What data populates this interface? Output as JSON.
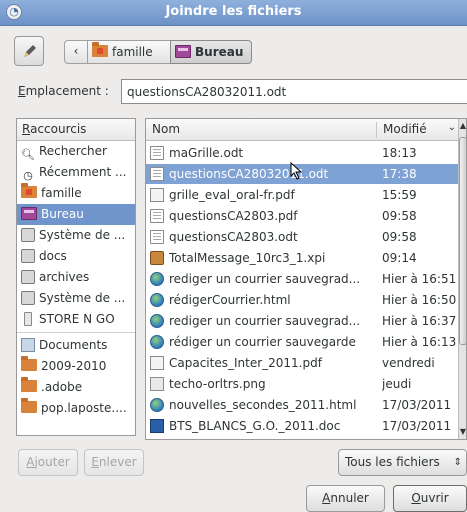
{
  "window": {
    "title": "Joindre les fichiers"
  },
  "path": {
    "back_label": "‹",
    "segments": [
      "famille",
      "Bureau"
    ]
  },
  "location": {
    "label_prefix": "",
    "label_accel": "E",
    "label_rest": "mplacement :",
    "value": "questionsCA28032011.odt"
  },
  "places": {
    "header_accel": "R",
    "header_rest": "accourcis",
    "items": [
      {
        "label": "Rechercher",
        "icon": "search-icon"
      },
      {
        "label": "Récemment ...",
        "icon": "recent-icon"
      },
      {
        "label": "famille",
        "icon": "home-folder-icon"
      },
      {
        "label": "Bureau",
        "icon": "desktop-icon",
        "selected": true
      },
      {
        "label": "Système de ...",
        "icon": "drive-icon"
      },
      {
        "label": "docs",
        "icon": "drive-icon"
      },
      {
        "label": "archives",
        "icon": "drive-icon"
      },
      {
        "label": "Système de ...",
        "icon": "drive-icon"
      },
      {
        "label": "STORE N GO",
        "icon": "usb-drive-icon"
      }
    ],
    "bookmarks": [
      {
        "label": "Documents",
        "icon": "documents-folder-icon"
      },
      {
        "label": "2009-2010",
        "icon": "folder-icon"
      },
      {
        "label": ".adobe",
        "icon": "folder-icon"
      },
      {
        "label": "pop.laposte....",
        "icon": "folder-icon"
      }
    ]
  },
  "files": {
    "col_name": "Nom",
    "col_modified": "Modifié",
    "sort_arrow": "⌄",
    "rows": [
      {
        "name": "maGrille.odt",
        "modified": "18:13",
        "icon": "document-icon"
      },
      {
        "name": "questionsCA28032011.odt",
        "modified": "17:38",
        "icon": "document-icon",
        "selected": true
      },
      {
        "name": "grille_eval_oral-fr.pdf",
        "modified": "15:59",
        "icon": "pdf-icon"
      },
      {
        "name": "questionsCA2803.pdf",
        "modified": "09:58",
        "icon": "document-icon"
      },
      {
        "name": "questionsCA2803.odt",
        "modified": "09:58",
        "icon": "document-icon"
      },
      {
        "name": "TotalMessage_10rc3_1.xpi",
        "modified": "09:14",
        "icon": "package-icon"
      },
      {
        "name": "rediger un courrier sauvegrad...",
        "modified": "Hier à 16:51",
        "icon": "globe-icon"
      },
      {
        "name": "rédigerCourrier.html",
        "modified": "Hier à 16:50",
        "icon": "globe-icon"
      },
      {
        "name": "rediger un courrier sauvegrad...",
        "modified": "Hier à 16:37",
        "icon": "globe-icon"
      },
      {
        "name": "rédiger un courrier sauvegarde",
        "modified": "Hier à 16:13",
        "icon": "globe-icon"
      },
      {
        "name": "Capacites_Inter_2011.pdf",
        "modified": "vendredi",
        "icon": "pdf-icon"
      },
      {
        "name": "techo-orltrs.png",
        "modified": "jeudi",
        "icon": "image-icon"
      },
      {
        "name": "nouvelles_secondes_2011.html",
        "modified": "17/03/2011",
        "icon": "globe-icon"
      },
      {
        "name": "BTS_BLANCS_G.O._2011.doc",
        "modified": "17/03/2011",
        "icon": "word-document-icon"
      }
    ]
  },
  "buttons": {
    "add_accel": "A",
    "add_rest": "jouter",
    "remove_accel": "E",
    "remove_rest": "nlever",
    "filter": "Tous les fichiers",
    "filter_arrows": "⇕",
    "cancel_accel": "A",
    "cancel_rest": "nnuler",
    "open_accel": "O",
    "open_rest": "uvrir"
  }
}
